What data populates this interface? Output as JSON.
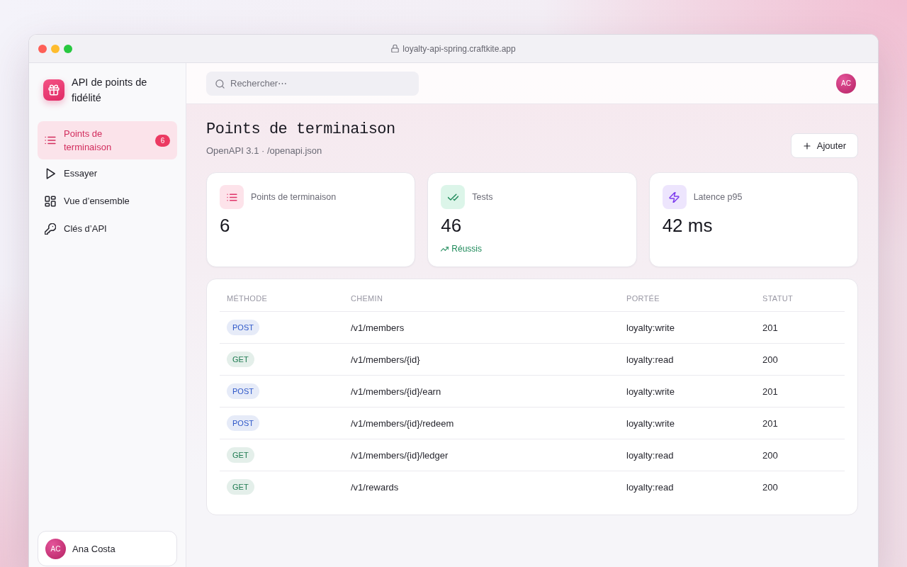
{
  "window": {
    "url": "loyalty-api-spring.craftkite.app"
  },
  "sidebar": {
    "app_name": "API de points de fidélité",
    "items": [
      {
        "label": "Points de terminaison",
        "selected": true,
        "badge": "6"
      },
      {
        "label": "Essayer",
        "selected": false
      },
      {
        "label": "Vue d’ensemble",
        "selected": false
      },
      {
        "label": "Clés d’API",
        "selected": false
      }
    ],
    "user": {
      "initials": "AC",
      "name": "Ana Costa"
    }
  },
  "topbar": {
    "search": {
      "placeholder": "Rechercher⋯"
    },
    "avatar": {
      "initials": "AC"
    }
  },
  "page": {
    "title": "Points de terminaison",
    "subtitle": "OpenAPI 3.1 · /openapi.json",
    "add_button": "Ajouter"
  },
  "stats": [
    {
      "kind": "endpoints",
      "label": "Points de terminaison",
      "value": "6"
    },
    {
      "kind": "tests",
      "label": "Tests",
      "value": "46",
      "trend": "Réussis"
    },
    {
      "kind": "latency",
      "label": "Latence p95",
      "value": "42 ms"
    }
  ],
  "table": {
    "columns": [
      "MÉTHODE",
      "CHEMIN",
      "PORTÉE",
      "STATUT"
    ],
    "rows": [
      {
        "method": {
          "label": "POST",
          "color": "#2f58c9"
        },
        "path": "/v1/members",
        "scope": "loyalty:write",
        "status": "201"
      },
      {
        "method": {
          "label": "GET",
          "color": "#1d7a50"
        },
        "path": "/v1/members/{id}",
        "scope": "loyalty:read",
        "status": "200"
      },
      {
        "method": {
          "label": "POST",
          "color": "#2f58c9"
        },
        "path": "/v1/members/{id}/earn",
        "scope": "loyalty:write",
        "status": "201"
      },
      {
        "method": {
          "label": "POST",
          "color": "#2f58c9"
        },
        "path": "/v1/members/{id}/redeem",
        "scope": "loyalty:write",
        "status": "201"
      },
      {
        "method": {
          "label": "GET",
          "color": "#1d7a50"
        },
        "path": "/v1/members/{id}/ledger",
        "scope": "loyalty:read",
        "status": "200"
      },
      {
        "method": {
          "label": "GET",
          "color": "#1d7a50"
        },
        "path": "/v1/rewards",
        "scope": "loyalty:read",
        "status": "200"
      }
    ]
  }
}
